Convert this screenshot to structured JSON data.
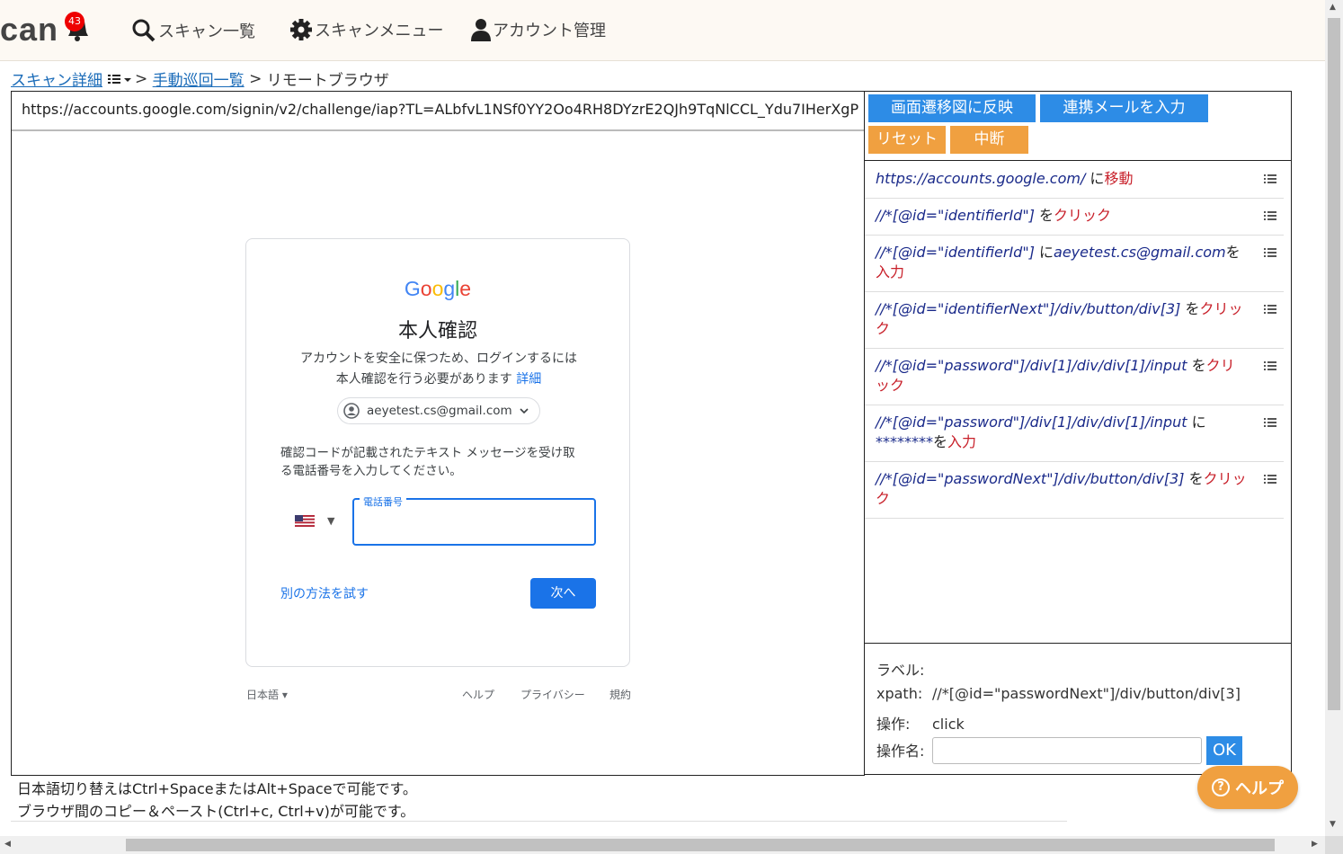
{
  "header": {
    "logo": "can",
    "badge_count": "43",
    "nav": [
      {
        "label": "スキャン一覧",
        "icon": "search-icon"
      },
      {
        "label": "スキャンメニュー",
        "icon": "gear-icon"
      },
      {
        "label": "アカウント管理",
        "icon": "user-icon"
      }
    ]
  },
  "breadcrumb": {
    "scan_detail": "スキャン詳細",
    "sep1": ">",
    "manual_list": "手動巡回一覧",
    "sep2": ">",
    "current": "リモートブラウザ"
  },
  "browser": {
    "url": "https://accounts.google.com/signin/v2/challenge/iap?TL=ALbfvL1NSf0YY2Oo4RH8DYzrE2QJh9TqNlCCL_Ydu7IHerXgP",
    "google": {
      "logo": "Google",
      "title": "本人確認",
      "desc_line1": "アカウントを安全に保つため、ログインするには",
      "desc_line2": "本人確認を行う必要があります",
      "desc_link": "詳細",
      "email": "aeyetest.cs@gmail.com",
      "msg_line1": "確認コードが記載されたテキスト メッセージを受け取",
      "msg_line2": "る電話番号を入力してください。",
      "phone_label": "電話番号",
      "alt_link": "別の方法を試す",
      "next_button": "次へ",
      "footer_lang": "日本語",
      "footer_help": "ヘルプ",
      "footer_privacy": "プライバシー",
      "footer_terms": "規約"
    }
  },
  "panel": {
    "buttons": {
      "reflect": "画面遷移図に反映",
      "mail": "連携メールを入力",
      "reset": "リセット",
      "abort": "中断"
    },
    "steps": [
      {
        "target": "https://accounts.google.com/",
        "mid": " に",
        "value": "",
        "after": "",
        "action": "移動"
      },
      {
        "target": "//*[@id=\"identifierId\"]",
        "mid": " を",
        "value": "",
        "after": "",
        "action": "クリック"
      },
      {
        "target": "//*[@id=\"identifierId\"]",
        "mid": " に",
        "value": "aeyetest.cs@gmail.com",
        "after": "を",
        "action": "入力"
      },
      {
        "target": "//*[@id=\"identifierNext\"]/div/button/div[3]",
        "mid": " を",
        "value": "",
        "after": "",
        "action": "クリック"
      },
      {
        "target": "//*[@id=\"password\"]/div[1]/div/div[1]/input",
        "mid": " を",
        "value": "",
        "after": "",
        "action": "クリック"
      },
      {
        "target": "//*[@id=\"password\"]/div[1]/div/div[1]/input",
        "mid": " に",
        "value": "********",
        "after": "を",
        "action": "入力"
      },
      {
        "target": "//*[@id=\"passwordNext\"]/div/button/div[3]",
        "mid": " を",
        "value": "",
        "after": "",
        "action": "クリック"
      }
    ],
    "detail": {
      "label_key": "ラベル:",
      "label_val": "",
      "xpath_key": "xpath:",
      "xpath_val": "//*[@id=\"passwordNext\"]/div/button/div[3]",
      "op_key": "操作:",
      "op_val": "click",
      "opname_key": "操作名:",
      "opname_val": "",
      "ok": "OK"
    }
  },
  "notes": {
    "line1": "日本語切り替えはCtrl+SpaceまたはAlt+Spaceで可能です。",
    "line2": "ブラウザ間のコピー＆ペースト(Ctrl+c, Ctrl+v)が可能です。"
  },
  "help_button": "ヘルプ"
}
